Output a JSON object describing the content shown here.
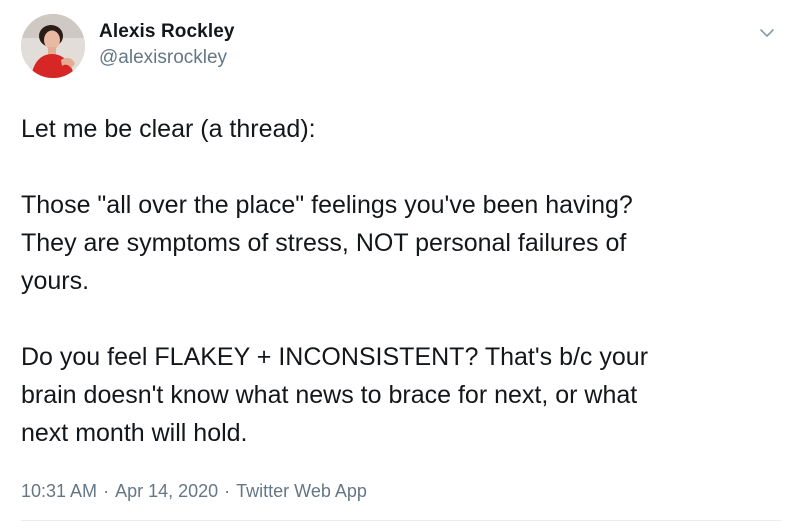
{
  "author": {
    "display_name": "Alexis Rockley",
    "handle": "@alexisrockley",
    "avatar_icon": "profile-photo"
  },
  "menu": {
    "icon": "chevron-down-icon"
  },
  "tweet": {
    "paragraphs": [
      "Let me be clear (a thread):",
      "Those \"all over the place\" feelings you've been having?\nThey are symptoms of stress, NOT personal failures of\nyours.",
      "Do you feel FLAKEY + INCONSISTENT? That's b/c your\nbrain doesn't know what news to brace for next, or what\nnext month will hold."
    ],
    "time": "10:31 AM",
    "date": "Apr 14, 2020",
    "separator": "·",
    "source": "Twitter Web App"
  },
  "colors": {
    "text": "#14171a",
    "secondary": "#657786",
    "divider": "#e6ecf0",
    "avatar_shirt": "#d62626"
  }
}
